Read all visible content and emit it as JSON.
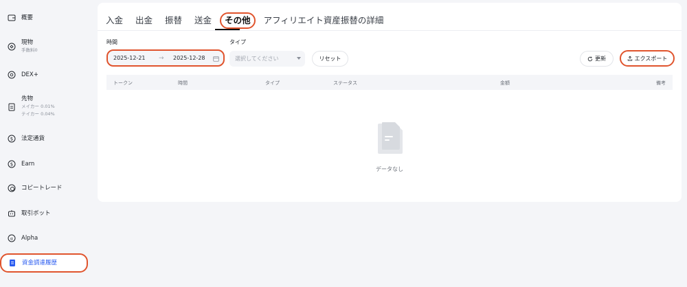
{
  "sidebar": {
    "items": [
      {
        "label": "概要",
        "sub": [],
        "icon": "wallet-icon"
      },
      {
        "label": "現物",
        "sub": [
          "手数料0"
        ],
        "icon": "spot-icon"
      },
      {
        "label": "DEX+",
        "sub": [],
        "icon": "dex-icon"
      },
      {
        "label": "先物",
        "sub": [
          "メイカー 0.01%",
          "テイカー 0.04%"
        ],
        "icon": "futures-icon"
      },
      {
        "label": "法定通貨",
        "sub": [],
        "icon": "fiat-icon"
      },
      {
        "label": "Earn",
        "sub": [],
        "icon": "earn-icon"
      },
      {
        "label": "コピートレード",
        "sub": [],
        "icon": "copy-trade-icon"
      },
      {
        "label": "取引ボット",
        "sub": [],
        "icon": "bot-icon"
      },
      {
        "label": "Alpha",
        "sub": [],
        "icon": "alpha-icon"
      },
      {
        "label": "資金調達履歴",
        "sub": [],
        "icon": "history-icon",
        "active": true
      }
    ]
  },
  "tabs": [
    "入金",
    "出金",
    "振替",
    "送金",
    "その他",
    "アフィリエイト資産振替の詳細"
  ],
  "active_tab": "その他",
  "filters": {
    "time_label": "時間",
    "date_start": "2025-12-21",
    "date_arrow": "→",
    "date_end": "2025-12-28",
    "type_label": "タイプ",
    "type_placeholder": "選択してください",
    "reset_label": "リセット",
    "refresh_label": "更新",
    "export_label": "エクスポート"
  },
  "table": {
    "columns": [
      "トークン",
      "時間",
      "タイプ",
      "ステータス",
      "金額",
      "備考"
    ]
  },
  "empty_text": "データなし",
  "colors": {
    "accent_blue": "#2b5cf0",
    "highlight_red": "#e0532c",
    "background": "#f4f5f8"
  }
}
